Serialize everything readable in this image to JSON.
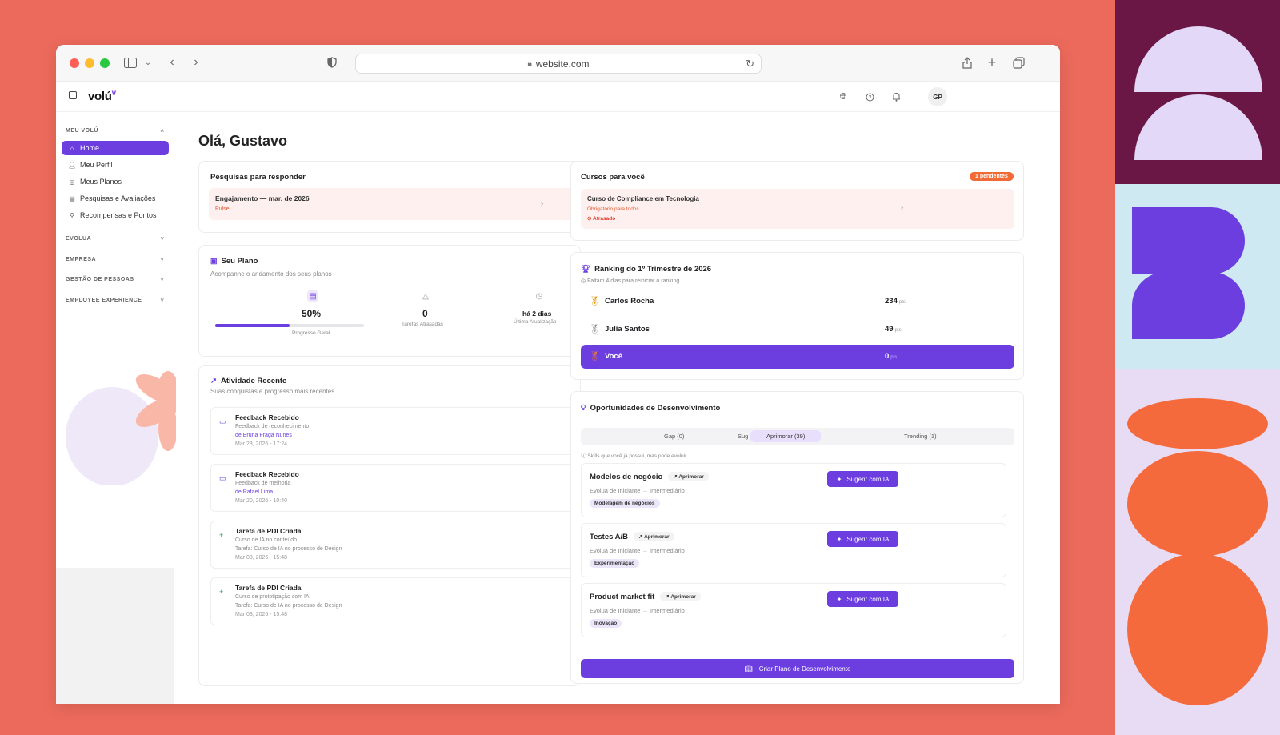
{
  "browser": {
    "url": "website.com"
  },
  "app": {
    "logo": "volú",
    "logo_mark": "v",
    "avatar_initials": "GP"
  },
  "sidebar": {
    "section_main": "MEU VOLÚ",
    "items": [
      {
        "label": "Home",
        "icon": "home-icon"
      },
      {
        "label": "Meu Perfil",
        "icon": "user-icon"
      },
      {
        "label": "Meus Planos",
        "icon": "target-icon"
      },
      {
        "label": "Pesquisas e Avaliações",
        "icon": "clipboard-icon"
      },
      {
        "label": "Recompensas e Pontos",
        "icon": "award-icon"
      }
    ],
    "sections": [
      "EVOLUA",
      "EMPRESA",
      "GESTÃO DE PESSOAS",
      "EMPLOYEE EXPERIENCE"
    ]
  },
  "greeting": "Olá, Gustavo",
  "surveys": {
    "title": "Pesquisas para responder",
    "item_title": "Engajamento — mar. de 2026",
    "item_type": "Pulse"
  },
  "courses": {
    "title": "Cursos para você",
    "badge": "1 pendentes",
    "item_title": "Curso de Compliance em Tecnologia",
    "item_sub": "Obrigatório para todos",
    "item_status": "Atrasado"
  },
  "plan": {
    "title": "Seu Plano",
    "subtitle": "Acompanhe o andamento dos seus planos",
    "progress_value": "50%",
    "progress_fraction": 0.5,
    "progress_label": "Progresso Geral",
    "late_value": "0",
    "late_label": "Tarefas Atrasadas",
    "update_value": "há 2 dias",
    "update_label": "Última Atualização"
  },
  "activity": {
    "title": "Atividade Recente",
    "subtitle": "Suas conquistas e progresso mais recentes",
    "items": [
      {
        "title": "Feedback Recebido",
        "line1": "Feedback de reconhecimento",
        "line2": "de Bruna Fraga Nunes",
        "date": "Mar 23, 2026 - 17:24"
      },
      {
        "title": "Feedback Recebido",
        "line1": "Feedback de melhoria",
        "line2": "de Rafael Lima",
        "date": "Mar 20, 2026 - 10:40"
      },
      {
        "title": "Tarefa de PDI Criada",
        "line1": "Curso de IA no conteúdo",
        "line2": "Tarefa: Curso de IA no processo de Design",
        "date": "Mar 03, 2026 - 15:48"
      },
      {
        "title": "Tarefa de PDI Criada",
        "line1": "Curso de prototipação com IA",
        "line2": "Tarefa: Curso de IA no processo de Design",
        "date": "Mar 03, 2026 - 15:48"
      }
    ]
  },
  "ranking": {
    "title": "Ranking do 1º Trimestre de 2026",
    "subtitle": "Faltam 4 dias para reiniciar o ranking",
    "pts_unit": "pts",
    "rows": [
      {
        "name": "Carlos Rocha",
        "points": "234"
      },
      {
        "name": "Julia Santos",
        "points": "49"
      },
      {
        "name": "Você",
        "points": "0"
      }
    ]
  },
  "opportunities": {
    "title": "Oportunidades de Desenvolvimento",
    "tabs": [
      "Gap (0)",
      "Sug",
      "Aprimorar (39)",
      "Trending (1)"
    ],
    "note": "Skills que você já possui, mas pode evoluir.",
    "chip": "Aprimorar",
    "action": "Sugerir com IA",
    "items": [
      {
        "title": "Modelos de negócio",
        "sub": "Evolua de Iniciante → Intermediário",
        "tag": "Modelagem de negócios"
      },
      {
        "title": "Testes A/B",
        "sub": "Evolua de Iniciante → Intermediário",
        "tag": "Experimentação"
      },
      {
        "title": "Product market fit",
        "sub": "Evolua de Iniciante → Intermediário",
        "tag": "Inovação"
      }
    ],
    "cta": "Criar Plano de Desenvolvimento"
  }
}
